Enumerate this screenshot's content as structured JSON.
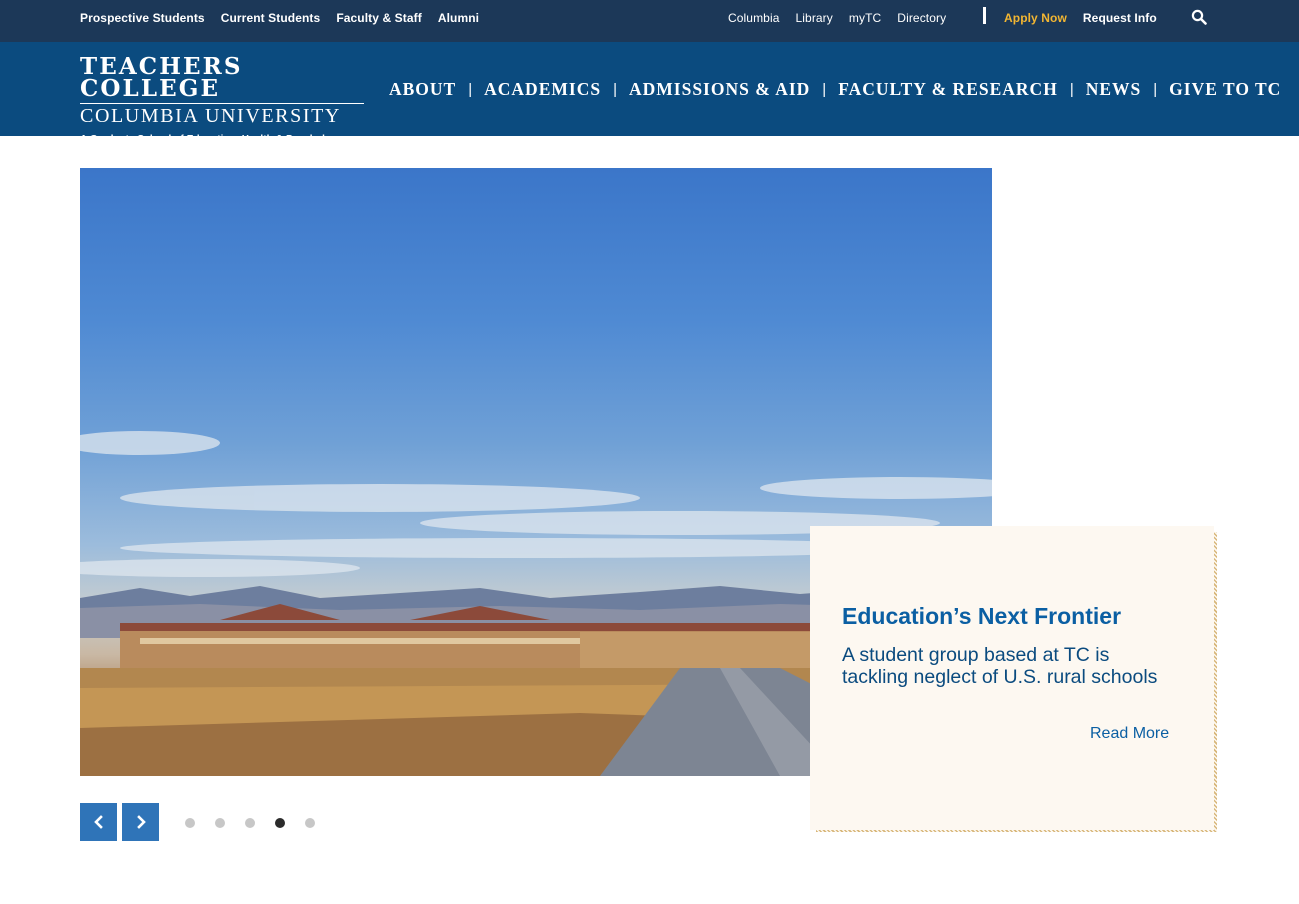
{
  "utility_nav": {
    "left_links": [
      "Prospective Students",
      "Current Students",
      "Faculty & Staff",
      "Alumni"
    ],
    "right_links": [
      "Columbia",
      "Library",
      "myTC",
      "Directory"
    ],
    "apply_label": "Apply Now",
    "request_label": "Request Info",
    "search_icon": "search-icon"
  },
  "logo": {
    "line1": "TEACHERS COLLEGE",
    "line2": "COLUMBIA UNIVERSITY",
    "line3": "A Graduate School of Education, Health & Psychology"
  },
  "main_nav": {
    "items": [
      "ABOUT",
      "ACADEMICS",
      "ADMISSIONS & AID",
      "FACULTY & RESEARCH",
      "NEWS",
      "GIVE TO TC"
    ]
  },
  "feature": {
    "title": "Education’s Next Frontier",
    "description": "A student group based at TC is tackling neglect of U.S. rural schools",
    "link_label": "Read More"
  },
  "carousel": {
    "slide_count": 5,
    "active_index": 3,
    "prev_icon": "chevron-left-icon",
    "next_icon": "chevron-right-icon"
  },
  "colors": {
    "utility_bg": "#1c3858",
    "nav_bg": "#0b4b7f",
    "apply_accent": "#f2b632",
    "card_bg": "#fdf8f1",
    "button_blue": "#2f74b8"
  }
}
